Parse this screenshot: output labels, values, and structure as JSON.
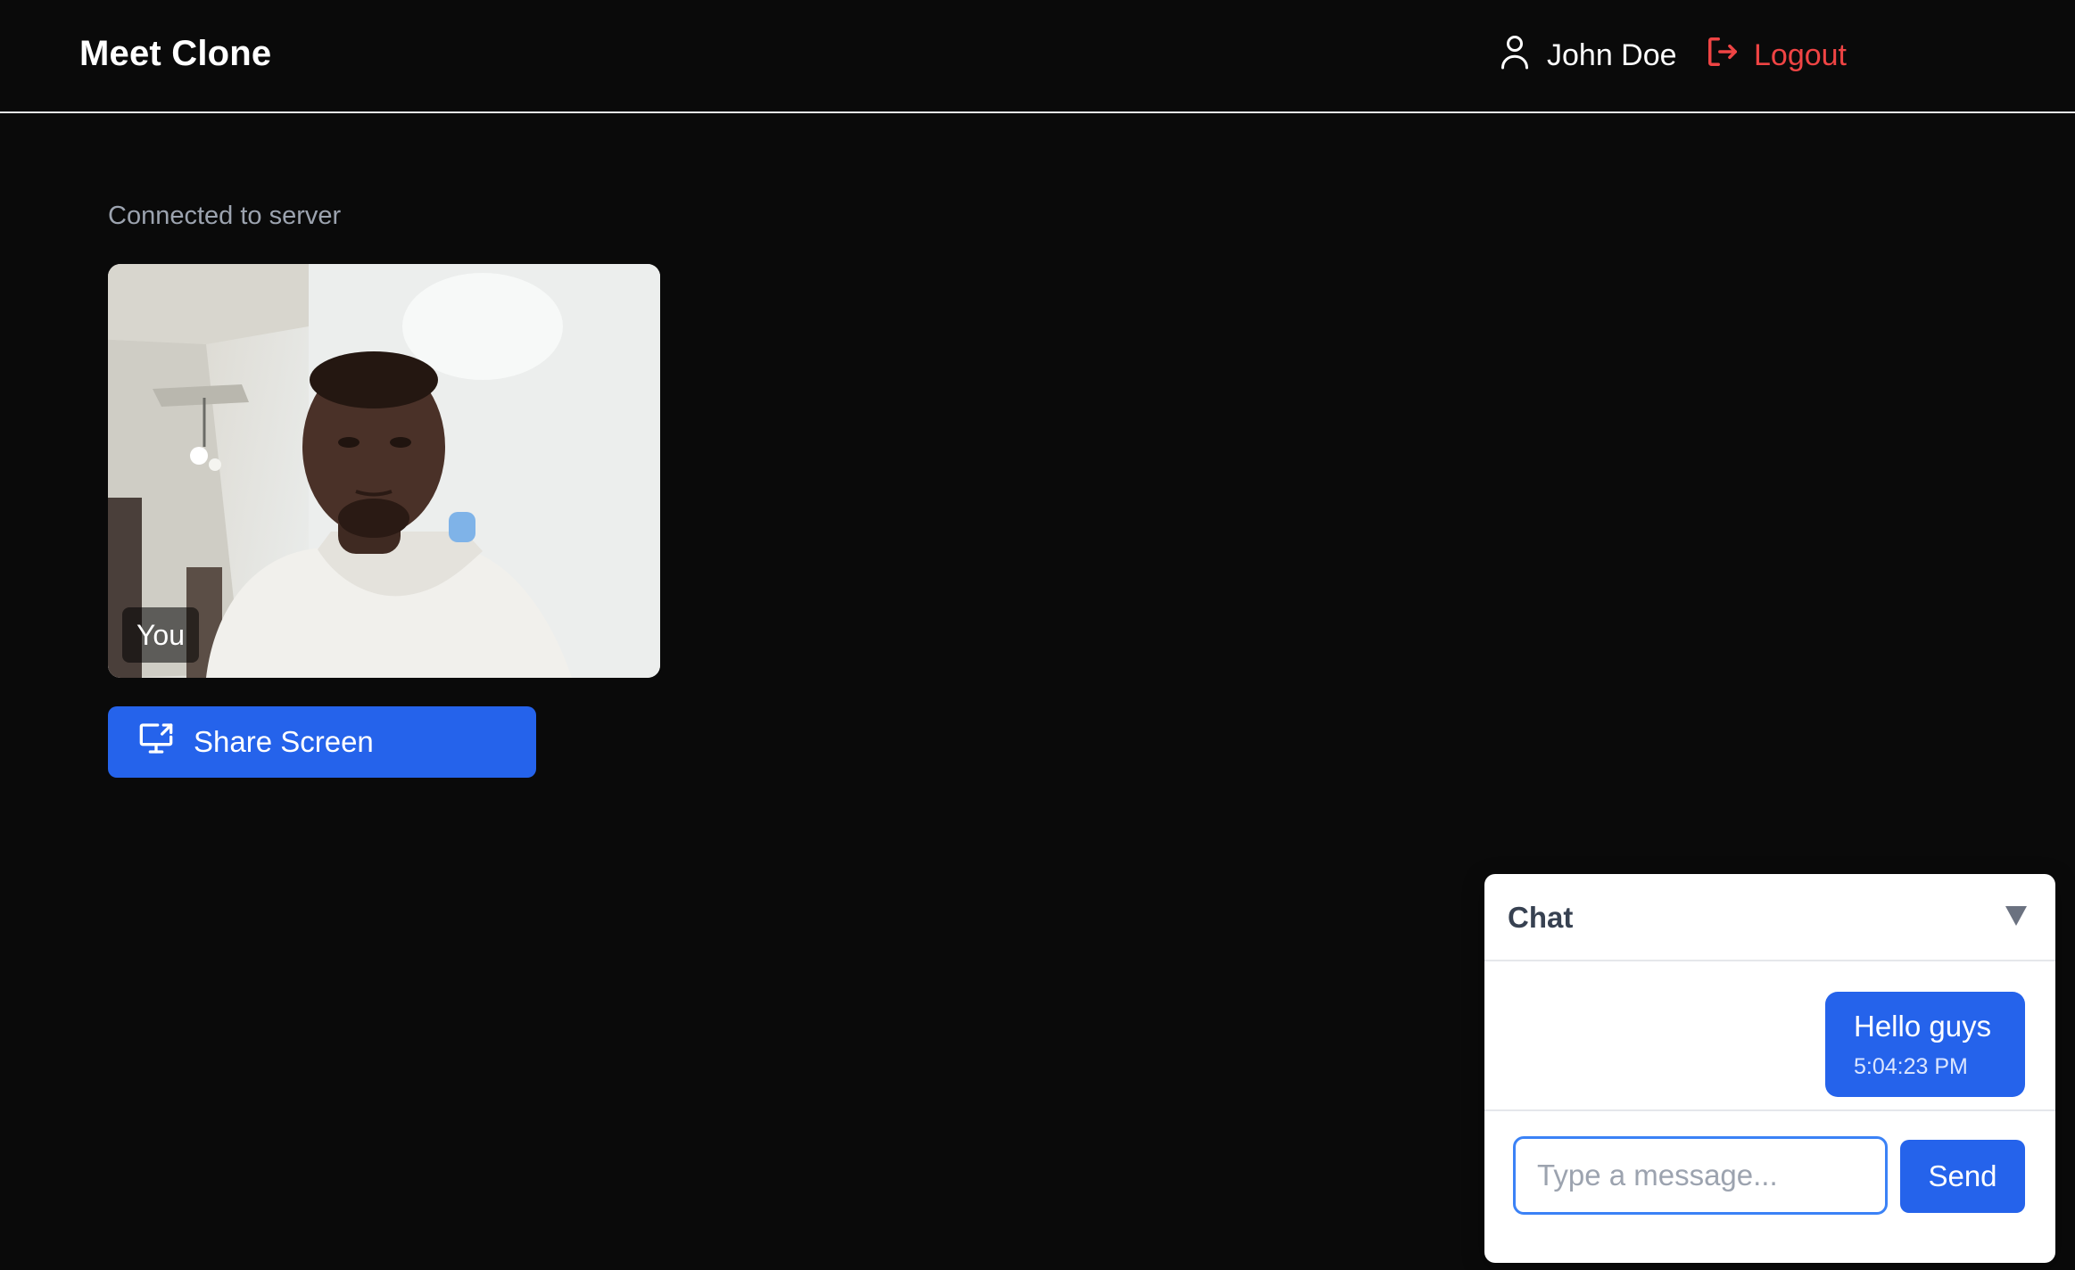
{
  "app": {
    "title": "Meet Clone"
  },
  "header": {
    "user_name": "John Doe",
    "user_icon": "user-icon",
    "logout_label": "Logout",
    "logout_icon": "logout-icon"
  },
  "main": {
    "status_text": "Connected to server",
    "local_video": {
      "label": "You"
    },
    "share_screen": {
      "label": "Share Screen",
      "icon": "share-screen-icon"
    }
  },
  "chat": {
    "title": "Chat",
    "toggle_icon": "collapse-triangle-icon",
    "messages": [
      {
        "text": "Hello guys",
        "time": "5:04:23 PM"
      }
    ],
    "input_placeholder": "Type a message...",
    "input_value": "",
    "send_label": "Send"
  },
  "colors": {
    "accent": "#2563eb",
    "danger": "#ef4444",
    "background": "#0a0a0a",
    "muted_text": "#9ca3af"
  }
}
